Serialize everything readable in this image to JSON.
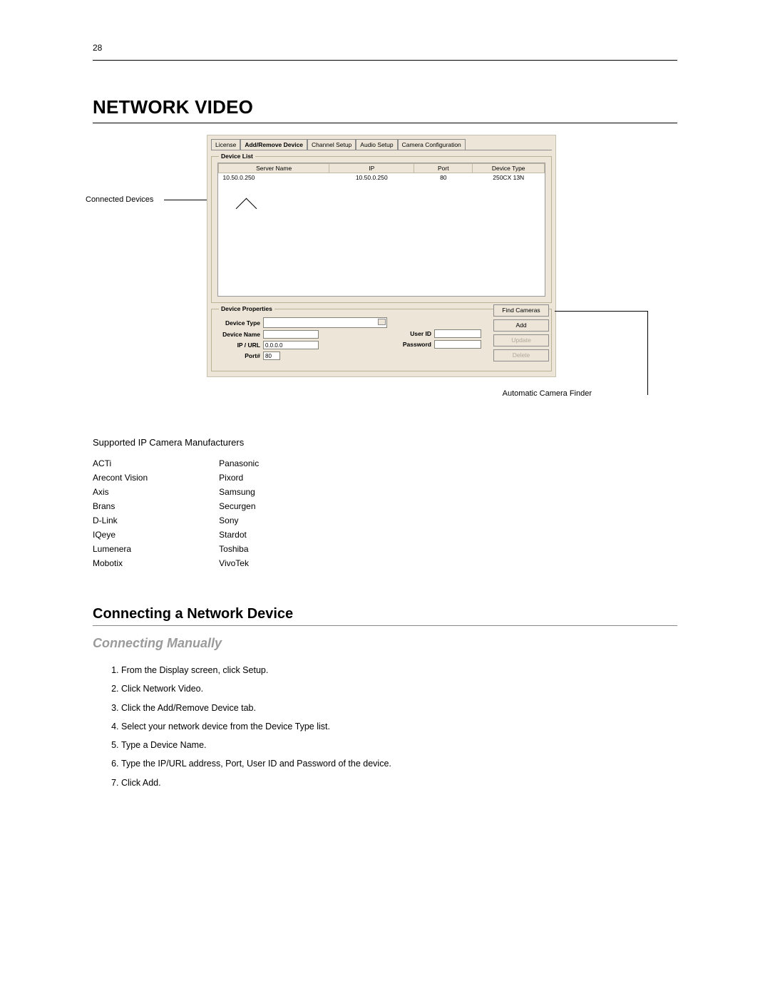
{
  "page_number": "28",
  "title": "NETWORK VIDEO",
  "callouts": {
    "connected_devices": "Connected Devices",
    "auto_finder": "Automatic Camera Finder"
  },
  "tabs": {
    "license": "License",
    "add_remove": "Add/Remove Device",
    "channel_setup": "Channel Setup",
    "audio_setup": "Audio Setup",
    "camera_config": "Camera Configuration"
  },
  "device_list": {
    "legend": "Device List",
    "cols": {
      "server_name": "Server Name",
      "ip": "IP",
      "port": "Port",
      "device_type": "Device Type"
    },
    "row": {
      "server_name": "10.50.0.250",
      "ip": "10.50.0.250",
      "port": "80",
      "device_type": "250CX 13N"
    }
  },
  "device_props": {
    "legend": "Device Properties",
    "labels": {
      "device_type": "Device Type",
      "device_name": "Device Name",
      "ip_url": "IP / URL",
      "port": "Port#",
      "user_id": "User ID",
      "password": "Password"
    },
    "values": {
      "ip_url": "0.0.0.0",
      "port": "80"
    }
  },
  "buttons": {
    "find": "Find Cameras",
    "add": "Add",
    "update": "Update",
    "delete": "Delete"
  },
  "manu_heading": "Supported IP Camera Manufacturers",
  "manu_col1": [
    "ACTi",
    "Arecont Vision",
    "Axis",
    "Brans",
    "D-Link",
    "IQeye",
    "Lumenera",
    "Mobotix"
  ],
  "manu_col2": [
    "Panasonic",
    "Pixord",
    "Samsung",
    "Securgen",
    "Sony",
    "Stardot",
    "Toshiba",
    "VivoTek"
  ],
  "sub_heading": "Connecting a Network Device",
  "sub_sub_heading": "Connecting Manually",
  "steps": [
    "From the Display screen, click Setup.",
    "Click Network Video.",
    "Click the Add/Remove Device tab.",
    "Select your network device from the Device Type list.",
    "Type a Device Name.",
    "Type the IP/URL address, Port, User ID and Password of the device.",
    "Click Add."
  ]
}
